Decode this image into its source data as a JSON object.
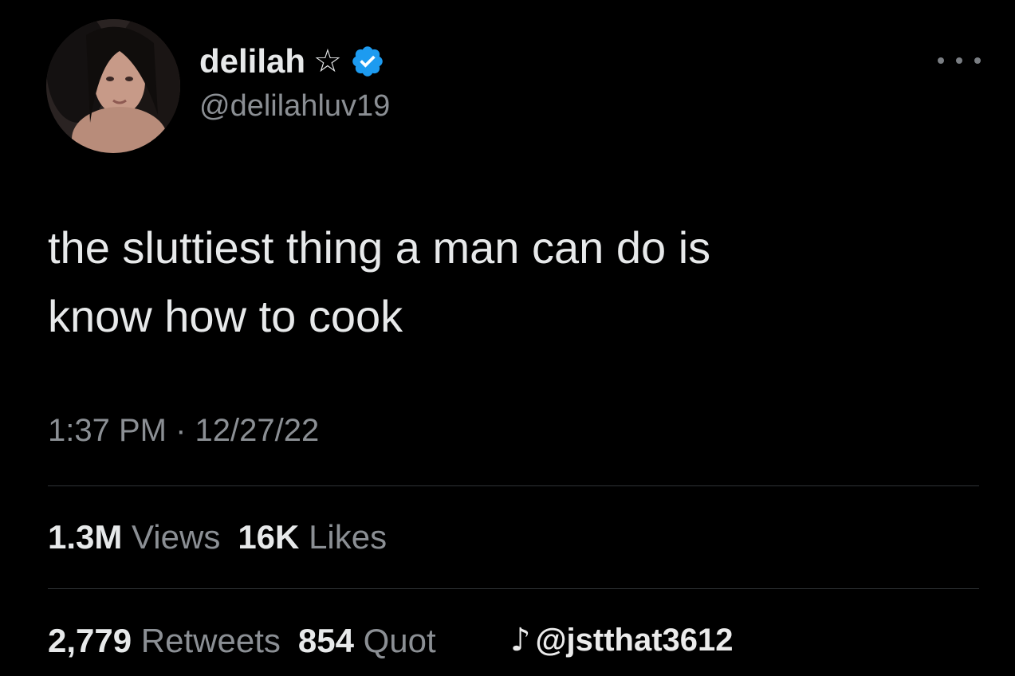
{
  "user": {
    "display_name": "delilah",
    "star_glyph": "☆",
    "handle": "@delilahluv19",
    "verified_color": "#1d9bf0"
  },
  "tweet": {
    "text_line1": "the sluttiest thing a man can do is",
    "text_line2": "know how to cook",
    "timestamp": "1:37 PM · 12/27/22"
  },
  "stats": {
    "views_count": "1.3M",
    "views_label": "Views",
    "likes_count": "16K",
    "likes_label": "Likes",
    "retweets_count": "2,779",
    "retweets_label": "Retweets",
    "quotes_count": "854",
    "quotes_label": "Quot"
  },
  "watermark": {
    "logo_glyph": "♪",
    "text": "@jstthat3612"
  },
  "icons": {
    "more": "more-icon",
    "verified": "verified-badge-icon",
    "star": "star-icon"
  },
  "colors": {
    "background": "#000000",
    "primary_text": "#e7e9ea",
    "secondary_text": "#8b8f94",
    "divider": "#2f3336"
  }
}
